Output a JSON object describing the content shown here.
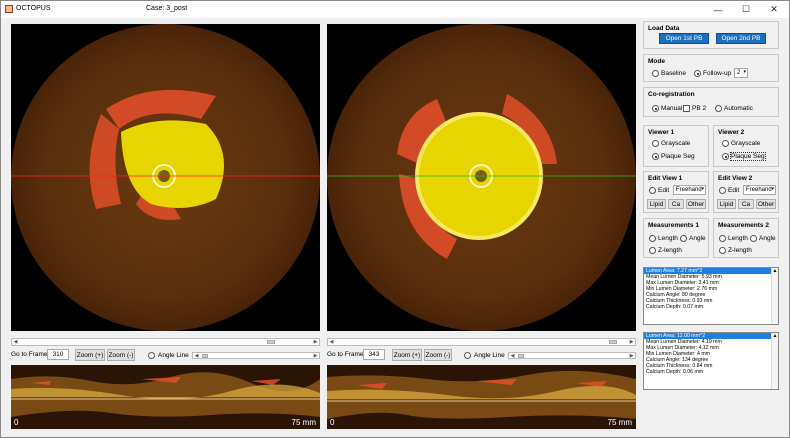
{
  "window": {
    "app_title": "OCTOPUS",
    "case_title": "Case: 3_post",
    "minimize_glyph": "—",
    "maximize_glyph": "☐",
    "close_glyph": "✕"
  },
  "left": {
    "go_to_frame_label": "Go to Frame",
    "frame_value": "310",
    "zoom_in_label": "Zoom (+)",
    "zoom_out_label": "Zoom (-)",
    "angle_line_label": "Angle Line",
    "long_start_label": "0",
    "long_end_label": "75 mm"
  },
  "right": {
    "go_to_frame_label": "Go to Frame",
    "frame_value": "343",
    "zoom_in_label": "Zoom (+)",
    "zoom_out_label": "Zoom (-)",
    "angle_line_label": "Angle Line",
    "long_start_label": "0",
    "long_end_label": "75 mm"
  },
  "load_data": {
    "title": "Load Data",
    "open1_label": "Open 1st PB",
    "open2_label": "Open 2nd PB"
  },
  "mode": {
    "title": "Mode",
    "baseline_label": "Baseline",
    "followup_label": "Follow-up",
    "followup_value": "2",
    "selected": "followup"
  },
  "coreg": {
    "title": "Co-registration",
    "manual_label": "Manual",
    "pb2_label": "PB 2",
    "automatic_label": "Automatic",
    "selected": "manual"
  },
  "viewer1": {
    "title": "Viewer 1",
    "grayscale_label": "Grayscale",
    "plaque_label": "Plaque Seg",
    "selected": "plaque"
  },
  "viewer2": {
    "title": "Viewer 2",
    "grayscale_label": "Grayscale",
    "plaque_label": "Plaque Seg",
    "selected": "plaque"
  },
  "edit1": {
    "title": "Edit View 1",
    "edit_label": "Edit",
    "mode_value": "Freehand",
    "lipid_label": "Lipid",
    "ca_label": "Ca",
    "other_label": "Other"
  },
  "edit2": {
    "title": "Edit View 2",
    "edit_label": "Edit",
    "mode_value": "Freehand",
    "lipid_label": "Lipid",
    "ca_label": "Ca",
    "other_label": "Other"
  },
  "meas1": {
    "title": "Measurements 1",
    "length_label": "Length",
    "angle_label": "Angle",
    "zlength_label": "Z-length"
  },
  "meas2": {
    "title": "Measurements 2",
    "length_label": "Length",
    "angle_label": "Angle",
    "zlength_label": "Z-length"
  },
  "results1": [
    "Lumen Area: 7.27 mm^2",
    "Mean Lumen Diameter: 5.93 mm",
    "Max Lumen Diameter: 3.41 mm",
    "Min Lumen Diameter: 2.76 mm",
    "Calcium Angle: 80 degree",
    "Calcium Thickness: 0.93 mm",
    "Calcium Depth: 0.07 mm"
  ],
  "results2": [
    "Lumen Area: 12.00 mm^2",
    "Mean Lumen Diameter: 4.19 mm",
    "Max Lumen Diameter: 4.12 mm",
    "Min Lumen Diameter: 4 mm",
    "Calcium Angle: 134 degree",
    "Calcium Thickness: 0.84 mm",
    "Calcium Depth: 0.06 mm"
  ],
  "colors": {
    "lumen_fill": "#e8d400",
    "calcium_fill": "#e8502a",
    "crosshair_red": "#ff2020",
    "crosshair_green": "#20c020",
    "button_blue": "#1f6fbf",
    "selection_blue": "#1e7fe0"
  }
}
